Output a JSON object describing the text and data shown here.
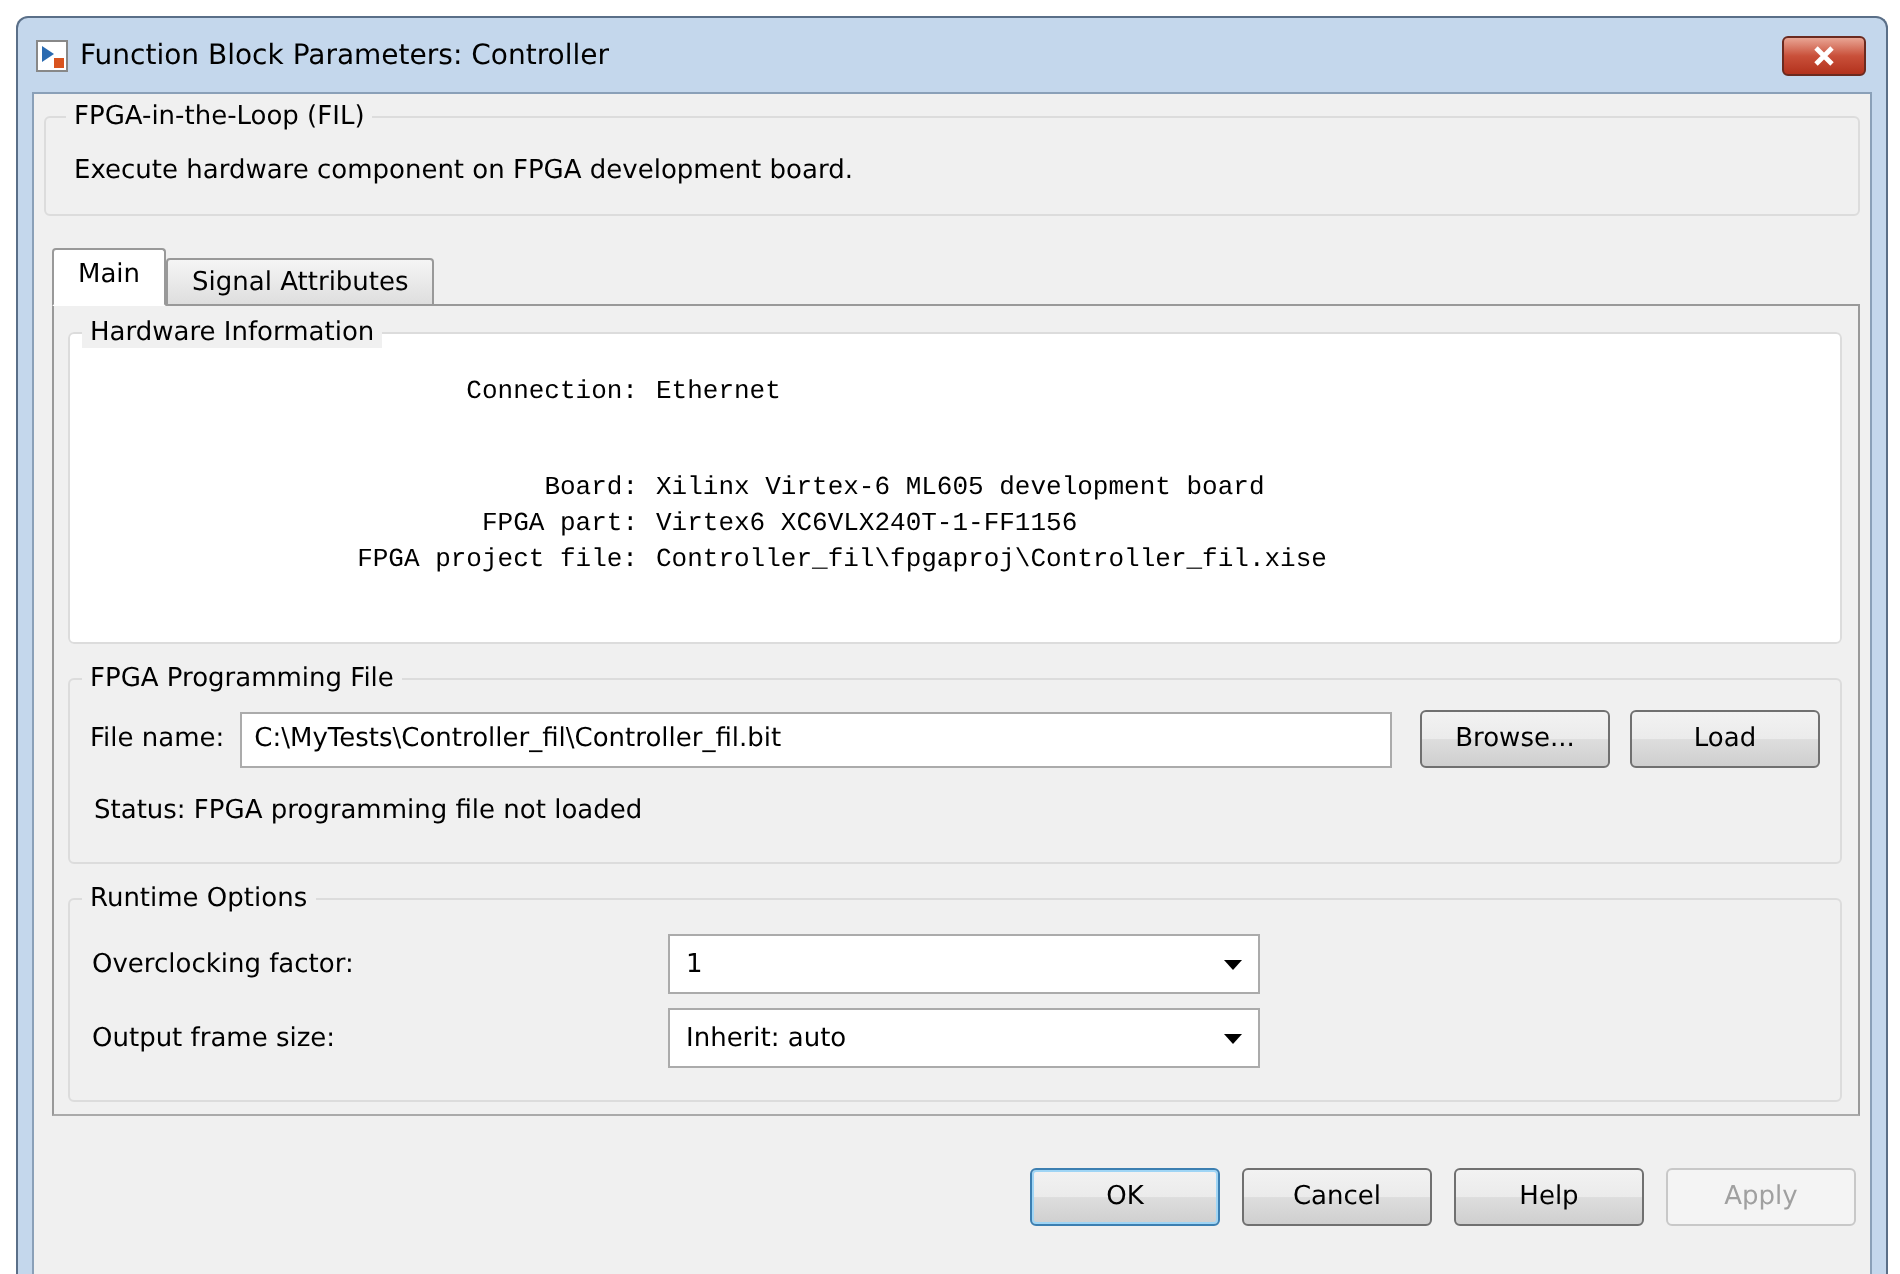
{
  "window": {
    "title": "Function Block Parameters: Controller"
  },
  "block": {
    "title": "FPGA-in-the-Loop (FIL)",
    "description": "Execute hardware component on FPGA development board."
  },
  "tabs": [
    {
      "label": "Main",
      "selected": true
    },
    {
      "label": "Signal Attributes",
      "selected": false
    }
  ],
  "hardware_information": {
    "title": "Hardware Information",
    "sections": [
      {
        "rows": [
          {
            "label": "Connection:",
            "value": "Ethernet"
          }
        ]
      },
      {
        "rows": [
          {
            "label": "Board:",
            "value": "Xilinx Virtex-6 ML605 development board"
          },
          {
            "label": "FPGA part:",
            "value": "Virtex6 XC6VLX240T-1-FF1156"
          },
          {
            "label": "FPGA project file:",
            "value": "Controller_fil\\fpgaproj\\Controller_fil.xise"
          }
        ]
      }
    ]
  },
  "programming_file": {
    "title": "FPGA Programming File",
    "file_label": "File name:",
    "file_value": "C:\\MyTests\\Controller_fil\\Controller_fil.bit",
    "buttons": [
      {
        "label": "Browse..."
      },
      {
        "label": "Load"
      }
    ],
    "status": "Status: FPGA programming file not loaded"
  },
  "runtime_options": {
    "title": "Runtime Options",
    "fields": [
      {
        "label": "Overclocking factor:",
        "value": "1"
      },
      {
        "label": "Output frame size:",
        "value": "Inherit: auto"
      }
    ]
  },
  "buttons": [
    {
      "label": "OK",
      "focused": true,
      "disabled": false
    },
    {
      "label": "Cancel",
      "focused": false,
      "disabled": false
    },
    {
      "label": "Help",
      "focused": false,
      "disabled": false
    },
    {
      "label": "Apply",
      "focused": false,
      "disabled": true
    }
  ]
}
